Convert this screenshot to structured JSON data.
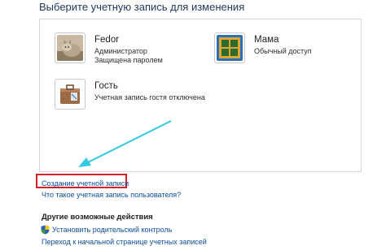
{
  "header": {
    "title": "Выберите учетную запись для изменения"
  },
  "accounts": [
    {
      "name": "Fedor",
      "line1": "Администратор",
      "line2": "Защищена паролем",
      "icon": "cat-avatar-icon"
    },
    {
      "name": "Мама",
      "line1": "Обычный доступ",
      "line2": "",
      "icon": "window-avatar-icon"
    },
    {
      "name": "Гость",
      "line1": "Учетная запись гостя отключена",
      "line2": "",
      "icon": "guest-briefcase-icon"
    }
  ],
  "links": {
    "create_account": "Создание учетной записи",
    "what_is_account": "Что такое учетная запись пользователя?"
  },
  "other_actions": {
    "heading": "Другие возможные действия",
    "parental_control": "Установить родительский контроль",
    "go_home": "Переход к начальной странице учетных записей"
  },
  "colors": {
    "title": "#1e395b",
    "link": "#0c4fa0",
    "highlight": "#d2232a",
    "arrow": "#33c9e0"
  }
}
